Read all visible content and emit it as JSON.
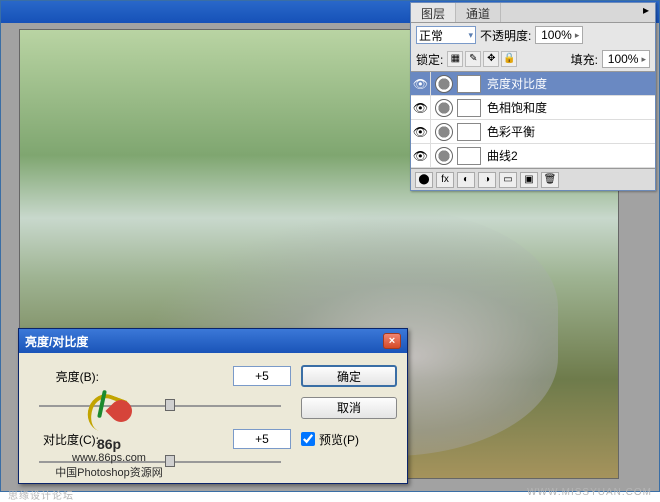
{
  "doc_window": {
    "title": ""
  },
  "layers_panel": {
    "tabs": [
      "图层",
      "通道"
    ],
    "blend_mode": "正常",
    "opacity_label": "不透明度:",
    "opacity_value": "100%",
    "lock_label": "锁定:",
    "fill_label": "填充:",
    "fill_value": "100%",
    "layers": [
      {
        "name": "亮度对比度",
        "selected": true
      },
      {
        "name": "色相饱和度",
        "selected": false
      },
      {
        "name": "色彩平衡",
        "selected": false
      },
      {
        "name": "曲线2",
        "selected": false
      }
    ]
  },
  "dialog": {
    "title": "亮度/对比度",
    "brightness_label": "亮度(B):",
    "brightness_value": "+5",
    "contrast_label": "对比度(C):",
    "contrast_value": "+5",
    "ok": "确定",
    "cancel": "取消",
    "preview": "预览(P)"
  },
  "watermark": {
    "badge": "86p",
    "url": "www.86ps.com",
    "cn": "中国Photoshop资源网"
  },
  "footer": {
    "left": "思缘设计论坛",
    "right": "WWW.MISSYUAN.COM"
  }
}
